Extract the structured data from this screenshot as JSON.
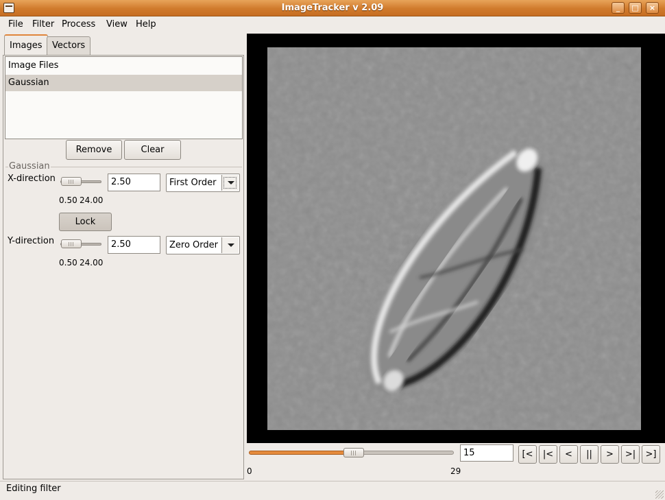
{
  "window": {
    "title": "ImageTracker v 2.09"
  },
  "menu": [
    "File",
    "Filter",
    "Process",
    "View",
    "Help"
  ],
  "tabs": [
    "Images",
    "Vectors"
  ],
  "image_list": {
    "items": [
      {
        "label": "Image Files",
        "selected": false
      },
      {
        "label": "Gaussian",
        "selected": true
      }
    ]
  },
  "list_buttons": {
    "remove": "Remove",
    "clear": "Clear"
  },
  "gaussian": {
    "group_title": "Gaussian",
    "x": {
      "label": "X-direction",
      "value": "2.50",
      "min": "0.50",
      "max": "24.00",
      "order": "First Order"
    },
    "lock": "Lock",
    "y": {
      "label": "Y-direction",
      "value": "2.50",
      "min": "0.50",
      "max": "24.00",
      "order": "Zero Order"
    }
  },
  "playback": {
    "frame": "15",
    "min": "0",
    "max": "29",
    "buttons": [
      "[<",
      "|<",
      "<",
      "||",
      ">",
      ">|",
      ">]"
    ]
  },
  "status": "Editing filter",
  "colors": {
    "accent": "#e0853a",
    "title_bar": "#d07a2c"
  }
}
